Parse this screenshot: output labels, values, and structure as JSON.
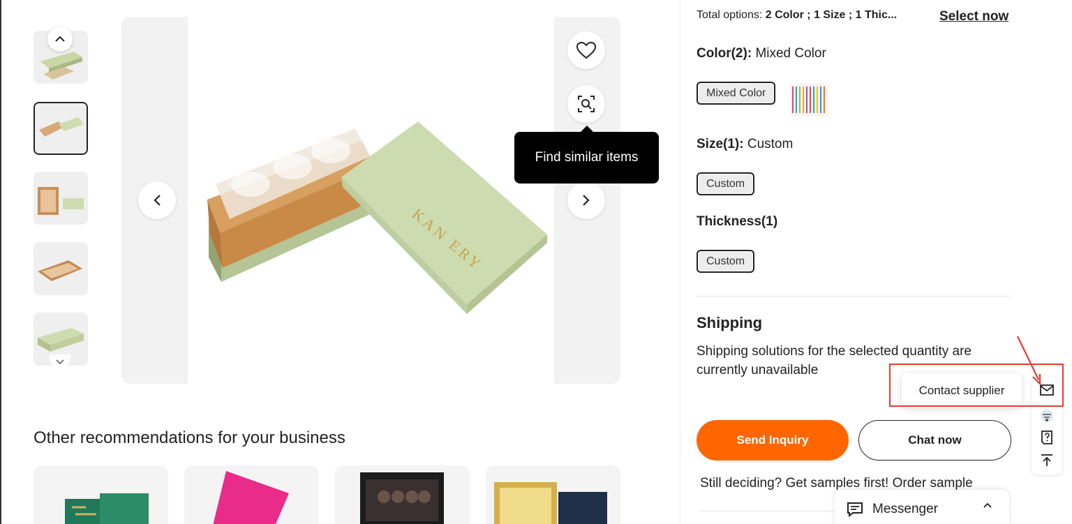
{
  "gallery": {
    "tooltip": "Find similar items"
  },
  "recommendations": {
    "title": "Other recommendations for your business"
  },
  "options": {
    "total_label": "Total options:",
    "total_value": "2 Color ; 1 Size ; 1 Thic...",
    "select_now": "Select now",
    "color_title": "Color(2):",
    "color_value": "Mixed Color",
    "color_chip": "Mixed Color",
    "size_title": "Size(1):",
    "size_value": "Custom",
    "size_chip": "Custom",
    "thickness_title": "Thickness(1)",
    "thickness_chip": "Custom"
  },
  "shipping": {
    "title": "Shipping",
    "text": "Shipping solutions for the selected quantity are currently unavailable"
  },
  "actions": {
    "send_inquiry": "Send Inquiry",
    "chat_now": "Chat now",
    "samples": "Still deciding? Get samples first! Order sample"
  },
  "side_toolbar": {
    "contact_supplier": "Contact supplier"
  },
  "messenger": {
    "label": "Messenger"
  },
  "colors": {
    "accent": "#ff6600",
    "annotation": "#e53d2f"
  }
}
